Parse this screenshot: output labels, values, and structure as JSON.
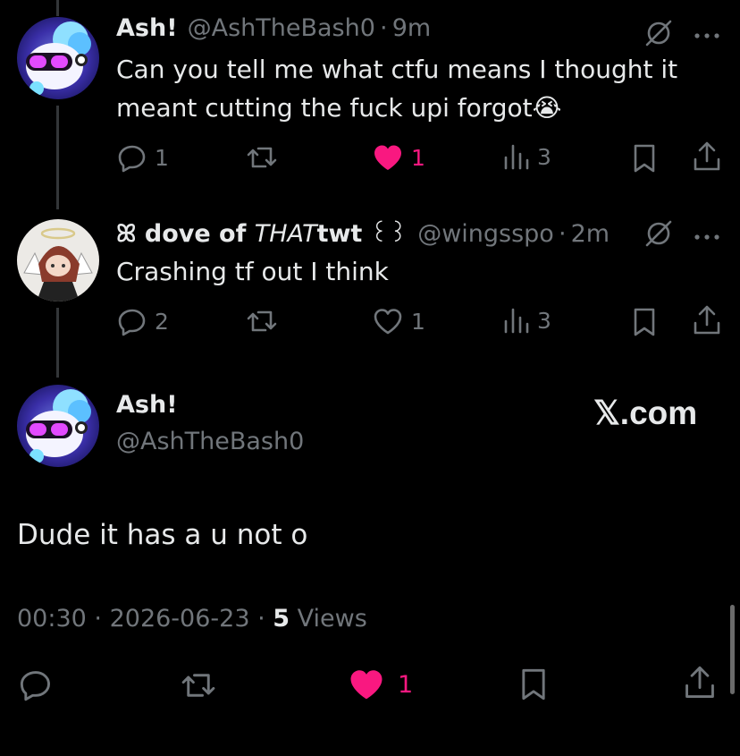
{
  "colors": {
    "background": "#000000",
    "text": "#e7e9ea",
    "muted": "#71767b",
    "like": "#f91880"
  },
  "replies": [
    {
      "name": "Ash!",
      "handle": "@AshTheBash0",
      "time": "9m",
      "text": "Can you tell me what ctfu means I thought it meant cutting the fuck upi forgot😭",
      "counts": {
        "reply": "1",
        "like": "1",
        "views": "3"
      },
      "liked": true,
      "icons": [
        "grok-icon",
        "more-icon",
        "reply-icon",
        "retweet-icon",
        "heart-icon",
        "views-icon",
        "bookmark-icon",
        "share-icon"
      ]
    },
    {
      "name_prefix": "ꕤ",
      "name_main": " dove of ",
      "name_italic": "THAT",
      "name_bold_end": "twt",
      "name_suffix": " ꒰꒱",
      "handle": "@wingsspo",
      "time": "2m",
      "text": "Crashing tf out I think",
      "counts": {
        "reply": "2",
        "like": "1",
        "views": "3"
      },
      "liked": false,
      "icons": [
        "grok-icon",
        "more-icon",
        "reply-icon",
        "retweet-icon",
        "heart-icon",
        "views-icon",
        "bookmark-icon",
        "share-icon"
      ]
    }
  ],
  "main": {
    "name": "Ash!",
    "handle": "@AshTheBash0",
    "brand": "𝕏.com",
    "text": "Dude it has a u not o",
    "time": "00:30",
    "date": "2026-06-23",
    "views_count": "5",
    "views_label": " Views",
    "like_count": "1",
    "liked": true
  },
  "separator": "·"
}
